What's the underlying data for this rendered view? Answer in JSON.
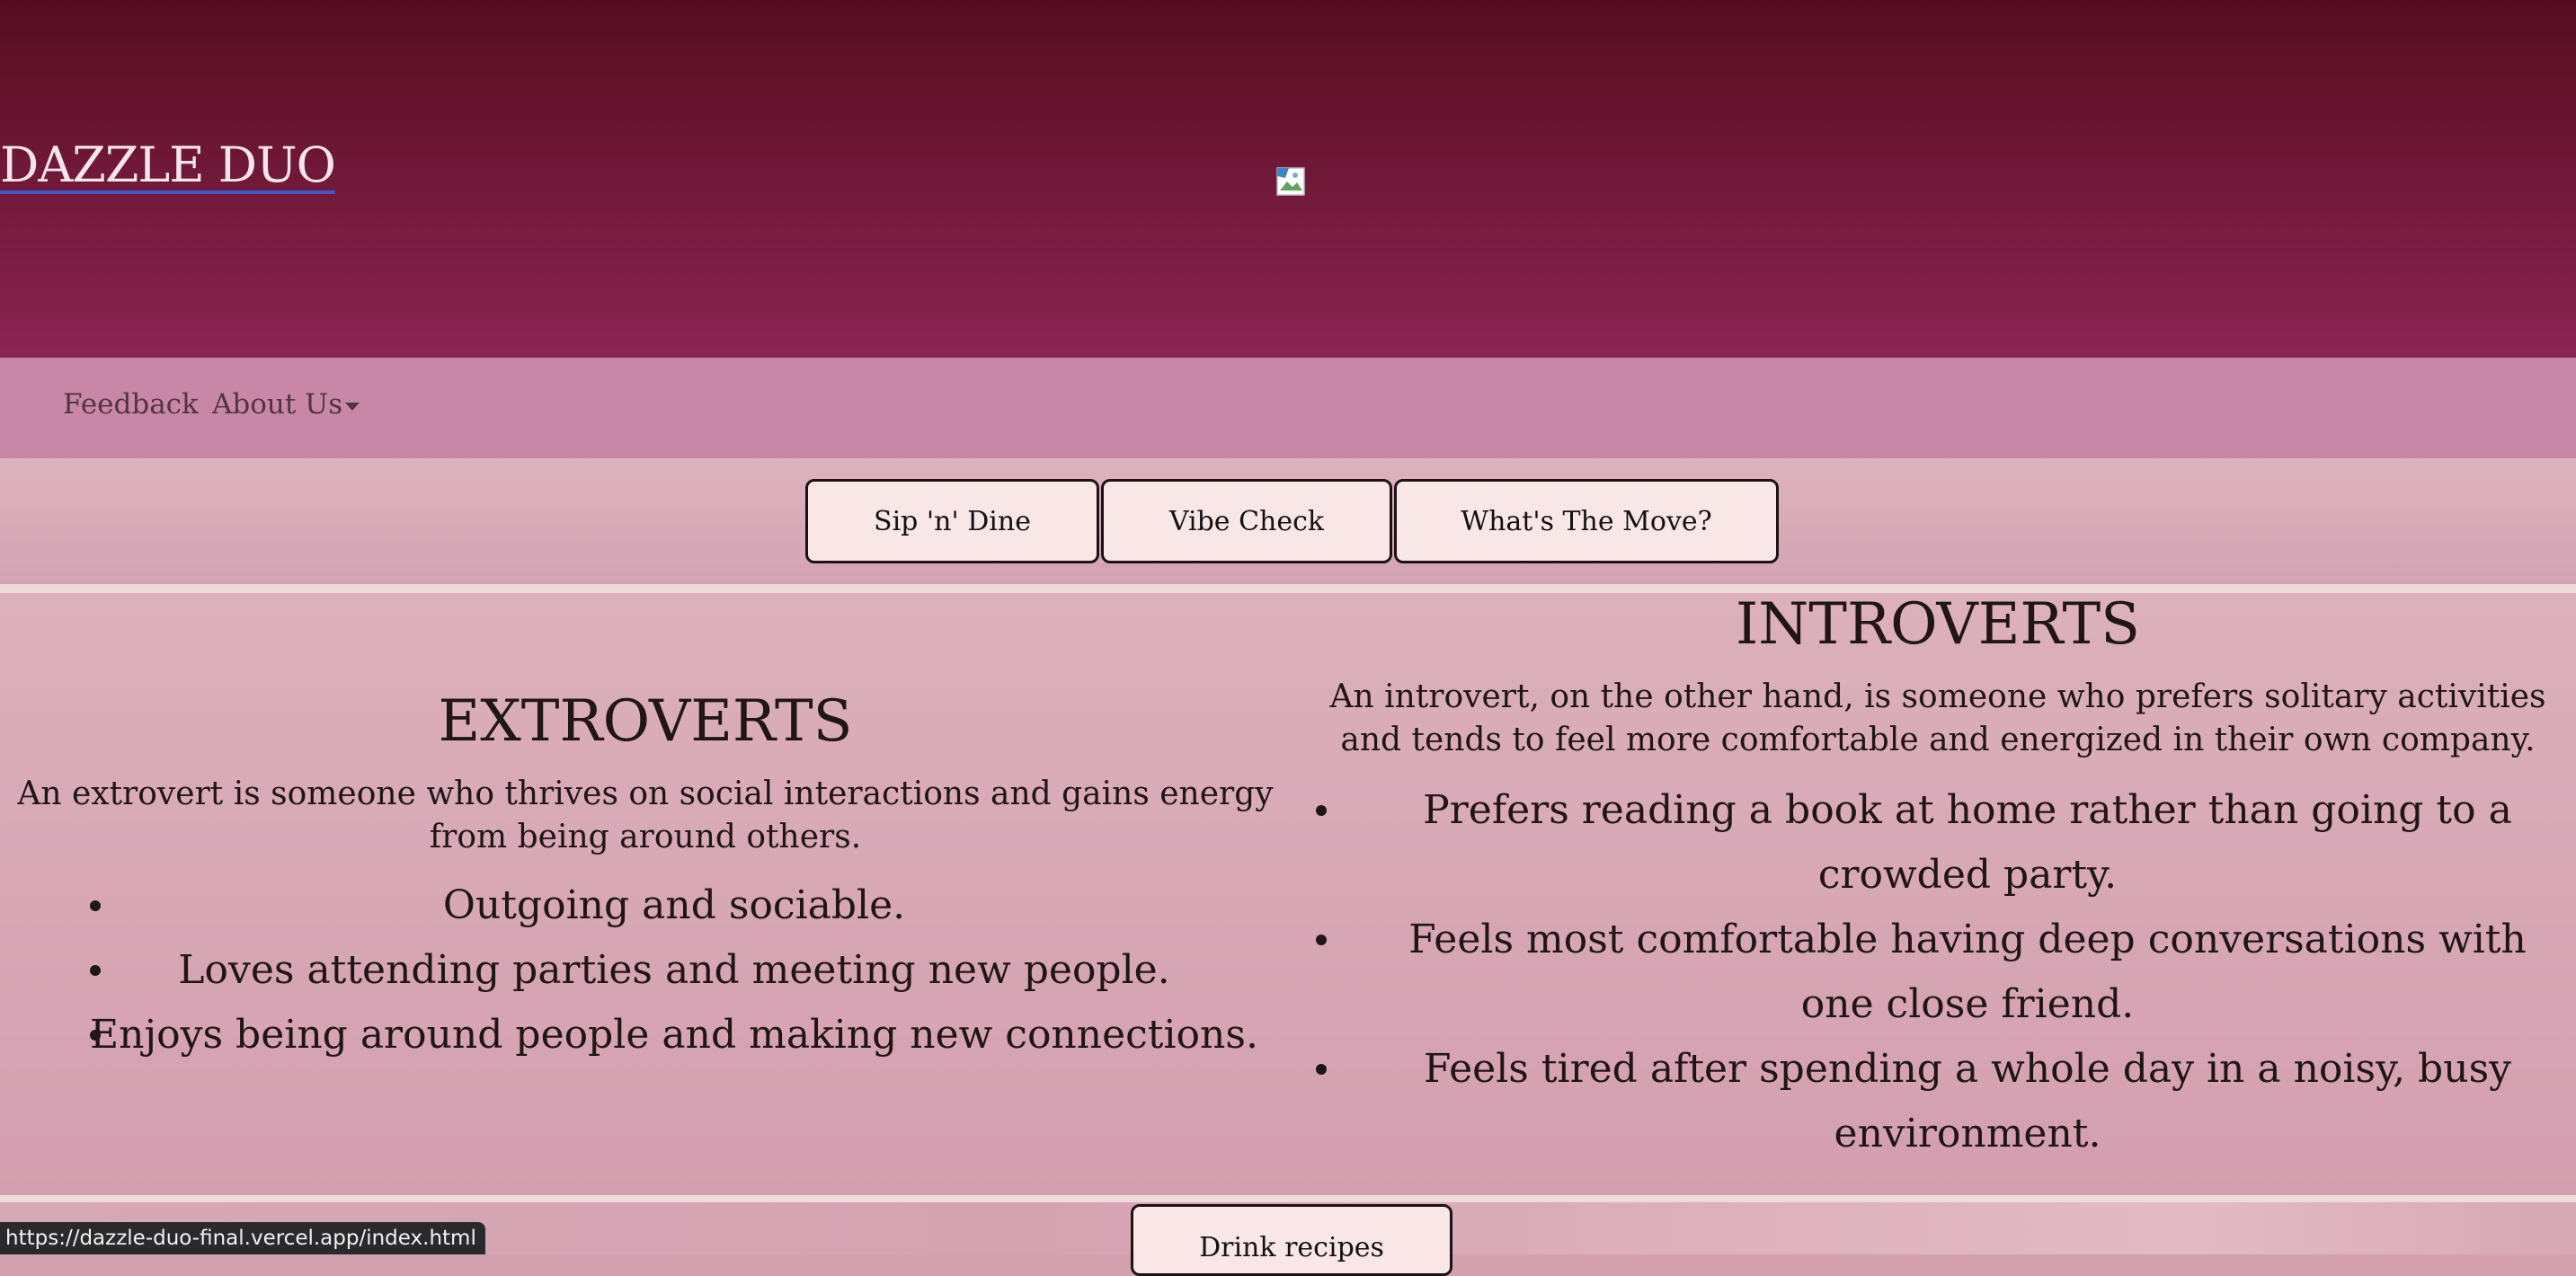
{
  "header": {
    "brand": "DAZZLE DUO",
    "logo_image": "broken-image-icon"
  },
  "nav": {
    "feedback": "Feedback",
    "about_us": "About Us",
    "about_us_icon": "caret-down-icon"
  },
  "tabs": [
    {
      "label": "Sip 'n' Dine"
    },
    {
      "label": "Vibe Check"
    },
    {
      "label": "What's The Move?"
    }
  ],
  "extroverts": {
    "title": "EXTROVERTS",
    "description": "An extrovert is someone who thrives on social interactions and gains energy from being around others.",
    "traits": [
      "Outgoing and sociable.",
      "Loves attending parties and meeting new people.",
      "Enjoys being around people and making new connections."
    ]
  },
  "introverts": {
    "title": "INTROVERTS",
    "description": "An introvert, on the other hand, is someone who prefers solitary activities and tends to feel more comfortable and energized in their own company.",
    "traits": [
      "Prefers reading a book at home rather than going to a crowded party.",
      "Feels most comfortable having deep conversations with one close friend.",
      "Feels tired after spending a whole day in a noisy, busy environment."
    ]
  },
  "footer": {
    "drink_button": "Drink recipes"
  },
  "status_bar": {
    "url": "https://dazzle-duo-final.vercel.app/index.html"
  },
  "colors": {
    "header_top": "#560d20",
    "header_bottom": "#8b2452",
    "nav_bg": "#c887a7",
    "button_bg": "#f9e6e6",
    "content_bg": "#d3a0b0"
  }
}
